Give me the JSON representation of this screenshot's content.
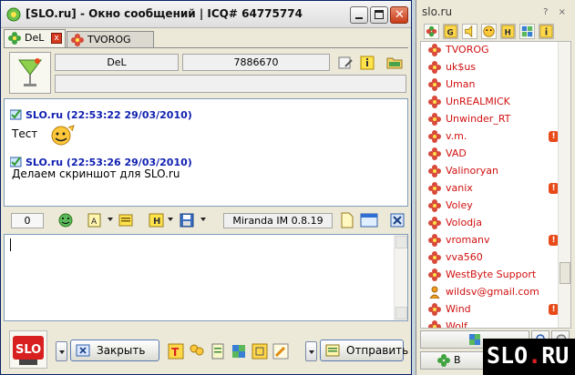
{
  "window": {
    "title": "[SLO.ru] - Окно сообщений | ICQ# 64775774",
    "min_label": "",
    "max_label": "",
    "close_label": "✕"
  },
  "tabs": [
    {
      "label": "DeL",
      "active": true,
      "close": "x"
    },
    {
      "label": "TVOROG",
      "active": false
    }
  ],
  "header": {
    "nick": "DeL",
    "uin": "7886670",
    "status_line": ""
  },
  "log": {
    "messages": [
      {
        "head": "SLO.ru (22:53:22 29/03/2010)",
        "text": "Тест"
      },
      {
        "head": "SLO.ru (22:53:26 29/03/2010)",
        "text": "Делаем скриншот для SLO.ru"
      }
    ]
  },
  "toolbar": {
    "counter": "0",
    "version": "Miranda IM 0.8.19"
  },
  "input": {
    "value": ""
  },
  "buttons": {
    "close_label": "Закрыть",
    "send_label": "Отправить"
  },
  "contactlist": {
    "title": "slo.ru",
    "controls": "? ×",
    "contacts": [
      {
        "name": "TVOROG",
        "away": false,
        "icon": "flower-icon"
      },
      {
        "name": "uk$us",
        "away": false,
        "icon": "flower-icon"
      },
      {
        "name": "Uman",
        "away": false,
        "icon": "flower-icon"
      },
      {
        "name": "UnREALMICK",
        "away": false,
        "icon": "flower-icon"
      },
      {
        "name": "Unwinder_RT",
        "away": false,
        "icon": "flower-icon"
      },
      {
        "name": "v.m.",
        "away": true,
        "icon": "flower-icon"
      },
      {
        "name": "VAD",
        "away": false,
        "icon": "flower-icon"
      },
      {
        "name": "Valinoryan",
        "away": false,
        "icon": "flower-icon"
      },
      {
        "name": "vanix",
        "away": true,
        "icon": "flower-icon"
      },
      {
        "name": "Voley",
        "away": false,
        "icon": "flower-icon"
      },
      {
        "name": "Volodja",
        "away": false,
        "icon": "flower-icon"
      },
      {
        "name": "vromanv",
        "away": true,
        "icon": "flower-icon"
      },
      {
        "name": "vva560",
        "away": false,
        "icon": "flower-icon"
      },
      {
        "name": "WestByte Support",
        "away": false,
        "icon": "flower-icon"
      },
      {
        "name": "wildsv@gmail.com",
        "away": false,
        "icon": "person-icon"
      },
      {
        "name": "Wind",
        "away": true,
        "icon": "flower-icon"
      },
      {
        "name": "Wolf",
        "away": false,
        "icon": "flower-icon"
      }
    ],
    "away_mark": "!",
    "status_button_prefix": "В"
  },
  "watermark": {
    "text_left": "SLO",
    "dot": ".",
    "text_right": "RU"
  },
  "colors": {
    "contact_text": "#d01010",
    "message_header": "#1020b0",
    "away_badge": "#e84b19"
  }
}
